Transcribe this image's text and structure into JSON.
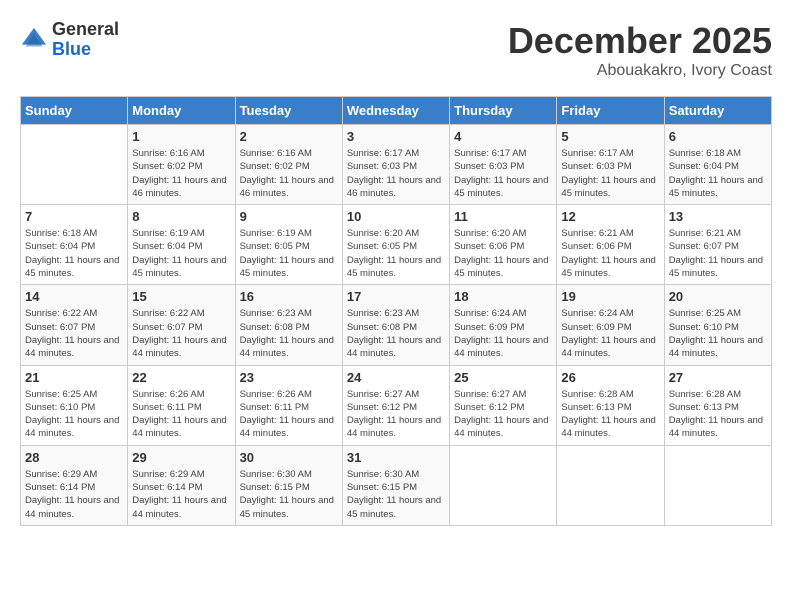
{
  "logo": {
    "general": "General",
    "blue": "Blue"
  },
  "title": {
    "month": "December 2025",
    "location": "Abouakakro, Ivory Coast"
  },
  "calendar": {
    "headers": [
      "Sunday",
      "Monday",
      "Tuesday",
      "Wednesday",
      "Thursday",
      "Friday",
      "Saturday"
    ],
    "rows": [
      [
        {
          "day": "",
          "sunrise": "",
          "sunset": "",
          "daylight": ""
        },
        {
          "day": "1",
          "sunrise": "Sunrise: 6:16 AM",
          "sunset": "Sunset: 6:02 PM",
          "daylight": "Daylight: 11 hours and 46 minutes."
        },
        {
          "day": "2",
          "sunrise": "Sunrise: 6:16 AM",
          "sunset": "Sunset: 6:02 PM",
          "daylight": "Daylight: 11 hours and 46 minutes."
        },
        {
          "day": "3",
          "sunrise": "Sunrise: 6:17 AM",
          "sunset": "Sunset: 6:03 PM",
          "daylight": "Daylight: 11 hours and 46 minutes."
        },
        {
          "day": "4",
          "sunrise": "Sunrise: 6:17 AM",
          "sunset": "Sunset: 6:03 PM",
          "daylight": "Daylight: 11 hours and 45 minutes."
        },
        {
          "day": "5",
          "sunrise": "Sunrise: 6:17 AM",
          "sunset": "Sunset: 6:03 PM",
          "daylight": "Daylight: 11 hours and 45 minutes."
        },
        {
          "day": "6",
          "sunrise": "Sunrise: 6:18 AM",
          "sunset": "Sunset: 6:04 PM",
          "daylight": "Daylight: 11 hours and 45 minutes."
        }
      ],
      [
        {
          "day": "7",
          "sunrise": "Sunrise: 6:18 AM",
          "sunset": "Sunset: 6:04 PM",
          "daylight": "Daylight: 11 hours and 45 minutes."
        },
        {
          "day": "8",
          "sunrise": "Sunrise: 6:19 AM",
          "sunset": "Sunset: 6:04 PM",
          "daylight": "Daylight: 11 hours and 45 minutes."
        },
        {
          "day": "9",
          "sunrise": "Sunrise: 6:19 AM",
          "sunset": "Sunset: 6:05 PM",
          "daylight": "Daylight: 11 hours and 45 minutes."
        },
        {
          "day": "10",
          "sunrise": "Sunrise: 6:20 AM",
          "sunset": "Sunset: 6:05 PM",
          "daylight": "Daylight: 11 hours and 45 minutes."
        },
        {
          "day": "11",
          "sunrise": "Sunrise: 6:20 AM",
          "sunset": "Sunset: 6:06 PM",
          "daylight": "Daylight: 11 hours and 45 minutes."
        },
        {
          "day": "12",
          "sunrise": "Sunrise: 6:21 AM",
          "sunset": "Sunset: 6:06 PM",
          "daylight": "Daylight: 11 hours and 45 minutes."
        },
        {
          "day": "13",
          "sunrise": "Sunrise: 6:21 AM",
          "sunset": "Sunset: 6:07 PM",
          "daylight": "Daylight: 11 hours and 45 minutes."
        }
      ],
      [
        {
          "day": "14",
          "sunrise": "Sunrise: 6:22 AM",
          "sunset": "Sunset: 6:07 PM",
          "daylight": "Daylight: 11 hours and 44 minutes."
        },
        {
          "day": "15",
          "sunrise": "Sunrise: 6:22 AM",
          "sunset": "Sunset: 6:07 PM",
          "daylight": "Daylight: 11 hours and 44 minutes."
        },
        {
          "day": "16",
          "sunrise": "Sunrise: 6:23 AM",
          "sunset": "Sunset: 6:08 PM",
          "daylight": "Daylight: 11 hours and 44 minutes."
        },
        {
          "day": "17",
          "sunrise": "Sunrise: 6:23 AM",
          "sunset": "Sunset: 6:08 PM",
          "daylight": "Daylight: 11 hours and 44 minutes."
        },
        {
          "day": "18",
          "sunrise": "Sunrise: 6:24 AM",
          "sunset": "Sunset: 6:09 PM",
          "daylight": "Daylight: 11 hours and 44 minutes."
        },
        {
          "day": "19",
          "sunrise": "Sunrise: 6:24 AM",
          "sunset": "Sunset: 6:09 PM",
          "daylight": "Daylight: 11 hours and 44 minutes."
        },
        {
          "day": "20",
          "sunrise": "Sunrise: 6:25 AM",
          "sunset": "Sunset: 6:10 PM",
          "daylight": "Daylight: 11 hours and 44 minutes."
        }
      ],
      [
        {
          "day": "21",
          "sunrise": "Sunrise: 6:25 AM",
          "sunset": "Sunset: 6:10 PM",
          "daylight": "Daylight: 11 hours and 44 minutes."
        },
        {
          "day": "22",
          "sunrise": "Sunrise: 6:26 AM",
          "sunset": "Sunset: 6:11 PM",
          "daylight": "Daylight: 11 hours and 44 minutes."
        },
        {
          "day": "23",
          "sunrise": "Sunrise: 6:26 AM",
          "sunset": "Sunset: 6:11 PM",
          "daylight": "Daylight: 11 hours and 44 minutes."
        },
        {
          "day": "24",
          "sunrise": "Sunrise: 6:27 AM",
          "sunset": "Sunset: 6:12 PM",
          "daylight": "Daylight: 11 hours and 44 minutes."
        },
        {
          "day": "25",
          "sunrise": "Sunrise: 6:27 AM",
          "sunset": "Sunset: 6:12 PM",
          "daylight": "Daylight: 11 hours and 44 minutes."
        },
        {
          "day": "26",
          "sunrise": "Sunrise: 6:28 AM",
          "sunset": "Sunset: 6:13 PM",
          "daylight": "Daylight: 11 hours and 44 minutes."
        },
        {
          "day": "27",
          "sunrise": "Sunrise: 6:28 AM",
          "sunset": "Sunset: 6:13 PM",
          "daylight": "Daylight: 11 hours and 44 minutes."
        }
      ],
      [
        {
          "day": "28",
          "sunrise": "Sunrise: 6:29 AM",
          "sunset": "Sunset: 6:14 PM",
          "daylight": "Daylight: 11 hours and 44 minutes."
        },
        {
          "day": "29",
          "sunrise": "Sunrise: 6:29 AM",
          "sunset": "Sunset: 6:14 PM",
          "daylight": "Daylight: 11 hours and 44 minutes."
        },
        {
          "day": "30",
          "sunrise": "Sunrise: 6:30 AM",
          "sunset": "Sunset: 6:15 PM",
          "daylight": "Daylight: 11 hours and 45 minutes."
        },
        {
          "day": "31",
          "sunrise": "Sunrise: 6:30 AM",
          "sunset": "Sunset: 6:15 PM",
          "daylight": "Daylight: 11 hours and 45 minutes."
        },
        {
          "day": "",
          "sunrise": "",
          "sunset": "",
          "daylight": ""
        },
        {
          "day": "",
          "sunrise": "",
          "sunset": "",
          "daylight": ""
        },
        {
          "day": "",
          "sunrise": "",
          "sunset": "",
          "daylight": ""
        }
      ]
    ]
  }
}
